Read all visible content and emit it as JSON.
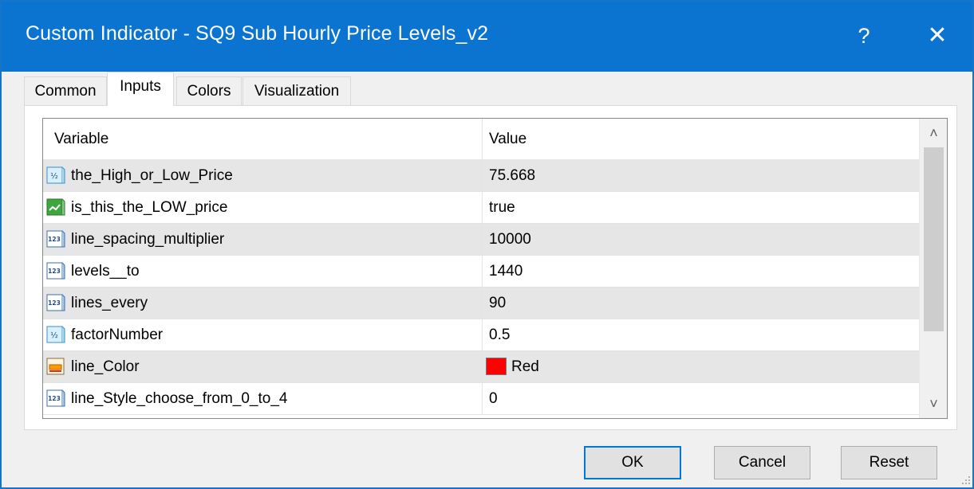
{
  "window": {
    "title": "Custom Indicator - SQ9 Sub Hourly Price Levels_v2",
    "help_label": "?",
    "close_label": "✕"
  },
  "tabs": [
    {
      "label": "Common",
      "active": false
    },
    {
      "label": "Inputs",
      "active": true
    },
    {
      "label": "Colors",
      "active": false
    },
    {
      "label": "Visualization",
      "active": false
    }
  ],
  "grid": {
    "columns": {
      "variable": "Variable",
      "value": "Value"
    },
    "rows": [
      {
        "icon": "double-type-icon",
        "icon_text": "½",
        "variable": "the_High_or_Low_Price",
        "value": "75.668"
      },
      {
        "icon": "bool-type-icon",
        "icon_text": "",
        "variable": "is_this_the_LOW_price",
        "value": "true"
      },
      {
        "icon": "int-type-icon",
        "icon_text": "123",
        "variable": "line_spacing_multiplier",
        "value": "10000"
      },
      {
        "icon": "int-type-icon",
        "icon_text": "123",
        "variable": "levels__to",
        "value": "1440"
      },
      {
        "icon": "int-type-icon",
        "icon_text": "123",
        "variable": "lines_every",
        "value": "90"
      },
      {
        "icon": "double-type-icon",
        "icon_text": "½",
        "variable": "factorNumber",
        "value": "0.5"
      },
      {
        "icon": "color-type-icon",
        "icon_text": "",
        "variable": "line_Color",
        "value": "Red",
        "swatch": "#ff0000"
      },
      {
        "icon": "int-type-icon",
        "icon_text": "123",
        "variable": "line_Style_choose_from_0_to_4",
        "value": "0"
      }
    ]
  },
  "scrollbar": {
    "up": "˄",
    "down": "˅"
  },
  "buttons": {
    "ok": "OK",
    "cancel": "Cancel",
    "reset": "Reset"
  },
  "colors": {
    "title_bar": "#0b74d0",
    "accent": "#0078d7",
    "swatch_red": "#ff0000"
  }
}
